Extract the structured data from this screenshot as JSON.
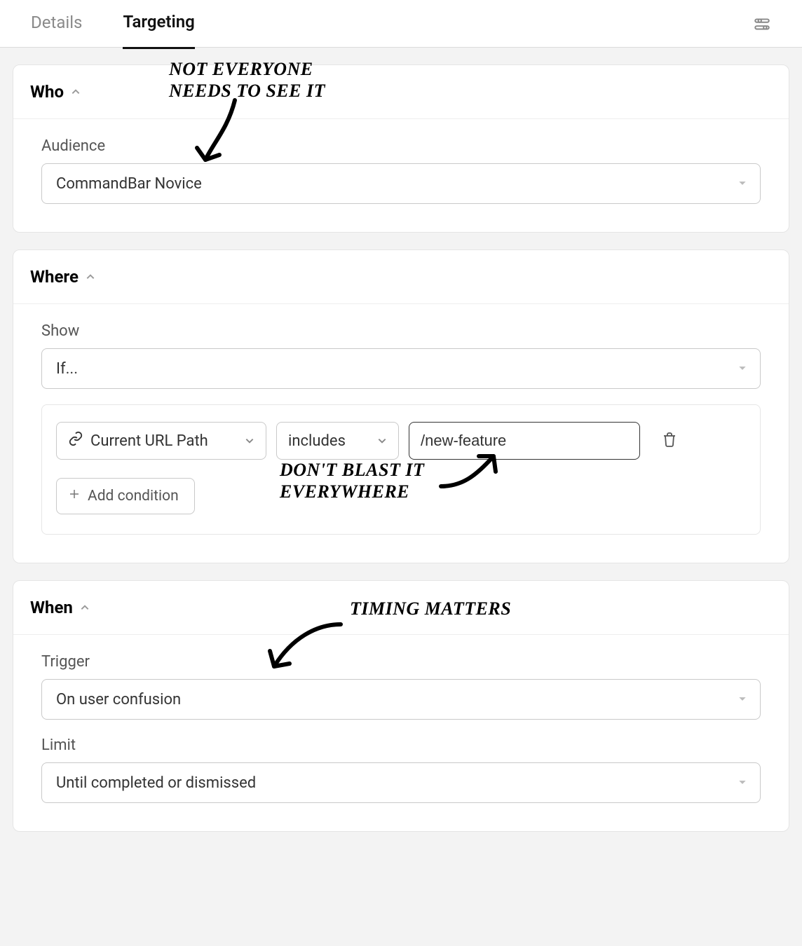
{
  "tabs": {
    "details": "Details",
    "targeting": "Targeting"
  },
  "who": {
    "title": "Who",
    "audience_label": "Audience",
    "audience_value": "CommandBar Novice"
  },
  "where": {
    "title": "Where",
    "show_label": "Show",
    "show_value": "If...",
    "condition_field": "Current URL Path",
    "condition_op": "includes",
    "condition_value": "/new-feature",
    "add_condition_label": "Add condition"
  },
  "when": {
    "title": "When",
    "trigger_label": "Trigger",
    "trigger_value": "On user confusion",
    "limit_label": "Limit",
    "limit_value": "Until completed or dismissed"
  },
  "annotations": {
    "who_note": "NOT EVERYONE\nNEEDS TO SEE IT",
    "where_note": "DON'T BLAST IT\nEVERYWHERE",
    "when_note": "TIMING MATTERS"
  }
}
